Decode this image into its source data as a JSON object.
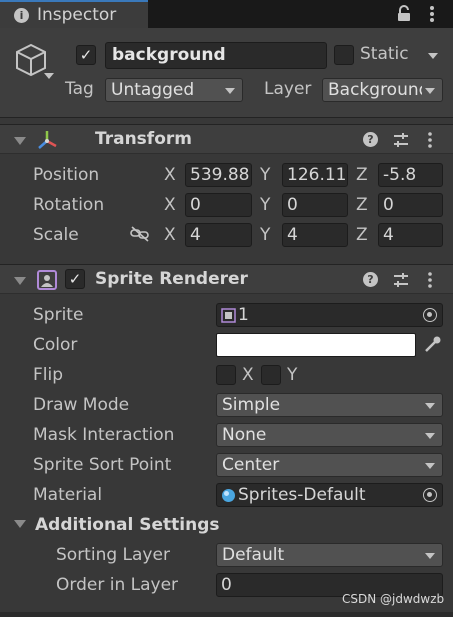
{
  "tab": {
    "title": "Inspector"
  },
  "gameobject": {
    "active": true,
    "name": "background",
    "static_label": "Static",
    "static_checked": false,
    "tag_label": "Tag",
    "tag_value": "Untagged",
    "layer_label": "Layer",
    "layer_value": "Background"
  },
  "transform": {
    "title": "Transform",
    "rows": [
      {
        "label": "Position",
        "x": "539.88",
        "y": "126.113",
        "z": "-5.8"
      },
      {
        "label": "Rotation",
        "x": "0",
        "y": "0",
        "z": "0"
      },
      {
        "label": "Scale",
        "x": "4",
        "y": "4",
        "z": "4"
      }
    ],
    "axis_x": "X",
    "axis_y": "Y",
    "axis_z": "Z"
  },
  "sprite_renderer": {
    "title": "Sprite Renderer",
    "enabled": true,
    "sprite_label": "Sprite",
    "sprite_value": "1",
    "color_label": "Color",
    "color_value": "#ffffff",
    "flip_label": "Flip",
    "flip_x_label": "X",
    "flip_y_label": "Y",
    "draw_mode_label": "Draw Mode",
    "draw_mode_value": "Simple",
    "mask_label": "Mask Interaction",
    "mask_value": "None",
    "sort_point_label": "Sprite Sort Point",
    "sort_point_value": "Center",
    "material_label": "Material",
    "material_value": "Sprites-Default",
    "additional_title": "Additional Settings",
    "sorting_layer_label": "Sorting Layer",
    "sorting_layer_value": "Default",
    "order_label": "Order in Layer",
    "order_value": "0"
  },
  "watermark": "CSDN @jdwdwzb",
  "colors": {
    "panel": "#383838",
    "header": "#3e3e3e",
    "field": "#2a2a2a",
    "accent": "#3a79bb"
  }
}
